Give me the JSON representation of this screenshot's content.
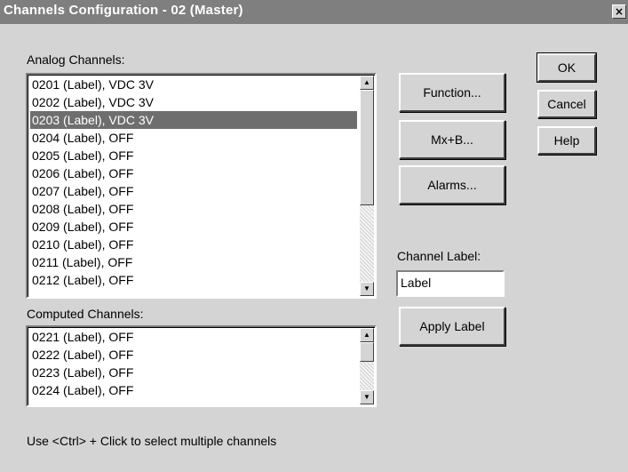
{
  "window": {
    "title": "Channels Configuration - 02 (Master)",
    "close_glyph": "×"
  },
  "analog": {
    "label": "Analog Channels:",
    "items": [
      "0201 (Label),  VDC  3V",
      "0202 (Label),  VDC  3V",
      "0203 (Label),  VDC  3V",
      "0204 (Label),  OFF",
      "0205 (Label),  OFF",
      "0206 (Label),  OFF",
      "0207 (Label),  OFF",
      "0208 (Label),  OFF",
      "0209 (Label),  OFF",
      "0210 (Label),  OFF",
      "0211 (Label),  OFF",
      "0212 (Label),  OFF"
    ],
    "selected_index": 2
  },
  "computed": {
    "label": "Computed Channels:",
    "items": [
      "0221 (Label),  OFF",
      "0222 (Label),  OFF",
      "0223 (Label),  OFF",
      "0224 (Label),  OFF"
    ]
  },
  "buttons": {
    "function": "Function...",
    "mxb": "Mx+B...",
    "alarms": "Alarms...",
    "ok": "OK",
    "cancel": "Cancel",
    "help": "Help",
    "apply": "Apply Label"
  },
  "channel_label": {
    "label": "Channel Label:",
    "value": "Label"
  },
  "hint": "Use <Ctrl> + Click to select multiple channels",
  "icons": {
    "scroll_up": "up-arrow-icon",
    "scroll_down": "down-arrow-icon"
  }
}
